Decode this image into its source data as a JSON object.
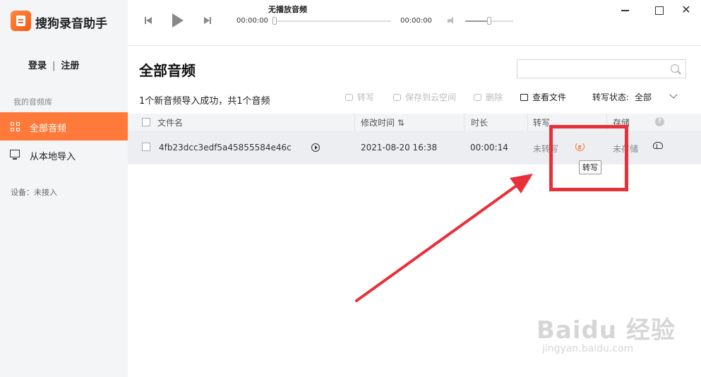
{
  "app": {
    "title": "搜狗录音助手"
  },
  "sidebar": {
    "login": "登录",
    "separator": "|",
    "register": "注册",
    "section_label": "我的音频库",
    "items": [
      {
        "label": "全部音频",
        "icon": "grid-icon",
        "active": true
      },
      {
        "label": "从本地导入",
        "icon": "monitor-icon",
        "active": false
      }
    ],
    "device_status": "设备：未接入"
  },
  "player": {
    "now_playing": "无播放音频",
    "current_time": "00:00:00",
    "total_time": "00:00:00",
    "volume_level": 0.45
  },
  "window_controls": {
    "close": "✕"
  },
  "main": {
    "title": "全部音频",
    "search_placeholder": "",
    "status_message": "1个新音频导入成功，共1个音频",
    "toolbar": {
      "transcribe": "转写",
      "save_cloud": "保存到云空间",
      "delete": "删除",
      "open_file": "查看文件",
      "status_label": "转写状态:",
      "status_value": "全部"
    },
    "table": {
      "headers": {
        "filename": "文件名",
        "modified": "修改时间 ⇅",
        "duration": "时长",
        "transcribe": "转写",
        "storage": "存储",
        "help": "?"
      },
      "rows": [
        {
          "filename": "4fb23dcc3edf5a45855584e46c",
          "modified": "2021-08-20  16:38",
          "duration": "00:00:14",
          "transcribe_status": "未转写",
          "storage_status": "未存储"
        }
      ]
    },
    "tooltip": "转写"
  },
  "colors": {
    "accent": "#ff7a3a",
    "annotation": "#e8303a",
    "sidebar_bg": "#f4f5f7"
  },
  "watermark": {
    "main": "Baidu 经验",
    "sub": "jingyan.baidu.com"
  }
}
